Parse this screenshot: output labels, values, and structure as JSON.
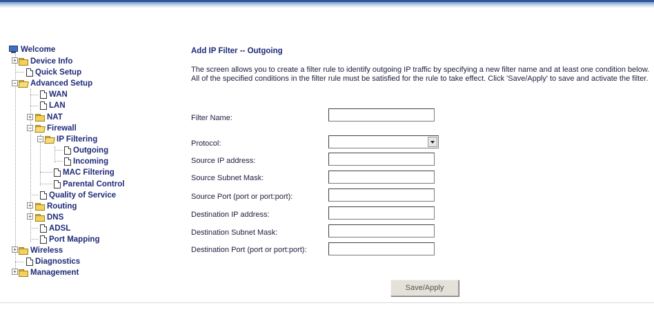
{
  "nav": {
    "welcome": "Welcome",
    "device_info": "Device Info",
    "quick_setup": "Quick Setup",
    "advanced_setup": "Advanced Setup",
    "wan": "WAN",
    "lan": "LAN",
    "nat": "NAT",
    "firewall": "Firewall",
    "ip_filtering": "IP Filtering",
    "outgoing": "Outgoing",
    "incoming": "Incoming",
    "mac_filtering": "MAC Filtering",
    "parental_control": "Parental Control",
    "quality_of_service": "Quality of Service",
    "routing": "Routing",
    "dns": "DNS",
    "adsl": "ADSL",
    "port_mapping": "Port Mapping",
    "wireless": "Wireless",
    "diagnostics": "Diagnostics",
    "management": "Management"
  },
  "expanders": {
    "plus": "+",
    "minus": "−"
  },
  "page": {
    "title": "Add IP Filter -- Outgoing",
    "description": "The screen allows you to create a filter rule to identify outgoing IP traffic by specifying a new filter name and at least one condition below. All of the specified conditions in the filter rule must be satisfied for the rule to take effect. Click 'Save/Apply' to save and activate the filter."
  },
  "form": {
    "filter_name": {
      "label": "Filter Name:",
      "value": ""
    },
    "protocol": {
      "label": "Protocol:",
      "value": ""
    },
    "source_ip": {
      "label": "Source IP address:",
      "value": ""
    },
    "source_mask": {
      "label": "Source Subnet Mask:",
      "value": ""
    },
    "source_port": {
      "label": "Source Port (port or port:port):",
      "value": ""
    },
    "dest_ip": {
      "label": "Destination IP address:",
      "value": ""
    },
    "dest_mask": {
      "label": "Destination Subnet Mask:",
      "value": ""
    },
    "dest_port": {
      "label": "Destination Port (port or port:port):",
      "value": ""
    }
  },
  "save_button": "Save/Apply"
}
